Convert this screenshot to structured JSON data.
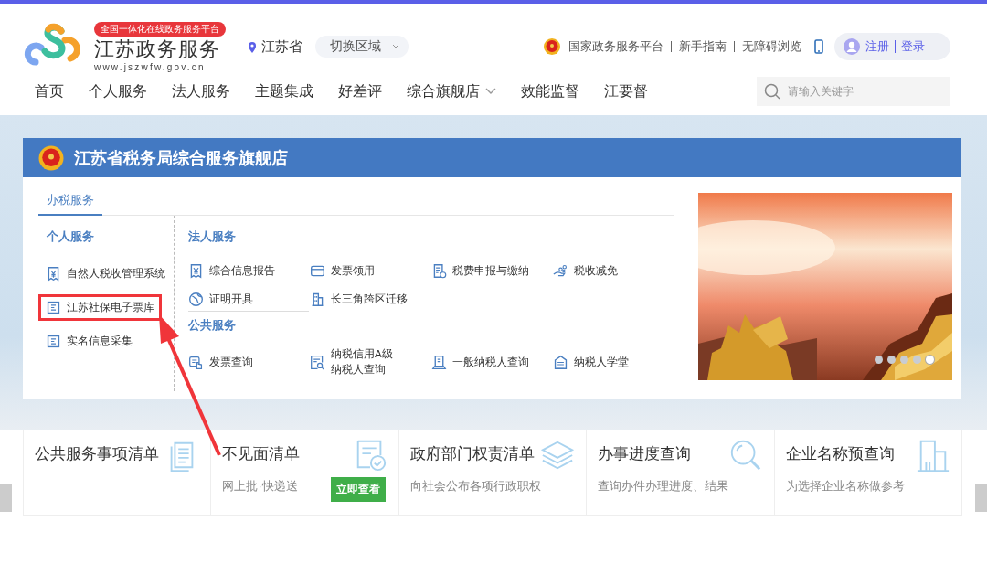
{
  "header": {
    "badge": "全国一体化在线政务服务平台",
    "site_name": "江苏政务服务",
    "url": "www.jszwfw.gov.cn",
    "location": "江苏省",
    "region_button": "切换区域",
    "links": [
      "国家政务服务平台",
      "新手指南",
      "无障碍浏览"
    ],
    "register": "注册",
    "login": "登录"
  },
  "nav": [
    {
      "label": "首页",
      "dropdown": false
    },
    {
      "label": "个人服务",
      "dropdown": false
    },
    {
      "label": "法人服务",
      "dropdown": false
    },
    {
      "label": "主题集成",
      "dropdown": false
    },
    {
      "label": "好差评",
      "dropdown": false
    },
    {
      "label": "综合旗舰店",
      "dropdown": true
    },
    {
      "label": "效能监督",
      "dropdown": false
    },
    {
      "label": "江要督",
      "dropdown": false
    }
  ],
  "search": {
    "placeholder": "请输入关键字"
  },
  "store": {
    "title": "江苏省税务局综合服务旗舰店",
    "tabs": [
      {
        "label": "办税服务",
        "selected": true
      }
    ],
    "personal": {
      "heading": "个人服务",
      "items": [
        {
          "label": "自然人税收管理系统",
          "kind": "receipt",
          "highlighted": false
        },
        {
          "label": "江苏社保电子票库",
          "kind": "form",
          "highlighted": true
        },
        {
          "label": "实名信息采集",
          "kind": "form",
          "highlighted": false
        }
      ]
    },
    "corporate": {
      "heading": "法人服务",
      "items": [
        {
          "label": "综合信息报告",
          "kind": "receipt"
        },
        {
          "label": "发票领用",
          "kind": "card"
        },
        {
          "label": "税费申报与缴纳",
          "kind": "declare"
        },
        {
          "label": "税收减免",
          "kind": "hand"
        },
        {
          "label": "证明开具",
          "kind": "globe"
        },
        {
          "label": "长三角跨区迁移",
          "kind": "building"
        }
      ]
    },
    "public": {
      "heading": "公共服务",
      "items": [
        {
          "label": "发票查询",
          "kind": "touch"
        },
        {
          "lines": [
            "纳税信用A级",
            "纳税人查询"
          ],
          "kind": "search"
        },
        {
          "label": "一般纳税人查询",
          "kind": "kiosk"
        },
        {
          "label": "纳税人学堂",
          "kind": "school"
        }
      ]
    },
    "carousel": {
      "kind": "picture",
      "dots": [
        {
          "selected": false
        },
        {
          "selected": false
        },
        {
          "selected": false
        },
        {
          "selected": false
        },
        {
          "selected": true
        }
      ]
    }
  },
  "quick_links": [
    {
      "title": "公共服务事项清单",
      "kind": "document"
    },
    {
      "title": "不见面清单",
      "subtitle": "网上批·快递送",
      "button": "立即查看",
      "kind": "certificate"
    },
    {
      "title": "政府部门权责清单",
      "subtitle": "向社会公布各项行政职权",
      "kind": "layers"
    },
    {
      "title": "办事进度查询",
      "subtitle": "查询办件办理进度、结果",
      "kind": "magnifier"
    },
    {
      "title": "企业名称预查询",
      "subtitle": "为选择企业名称做参考",
      "kind": "building"
    }
  ]
}
